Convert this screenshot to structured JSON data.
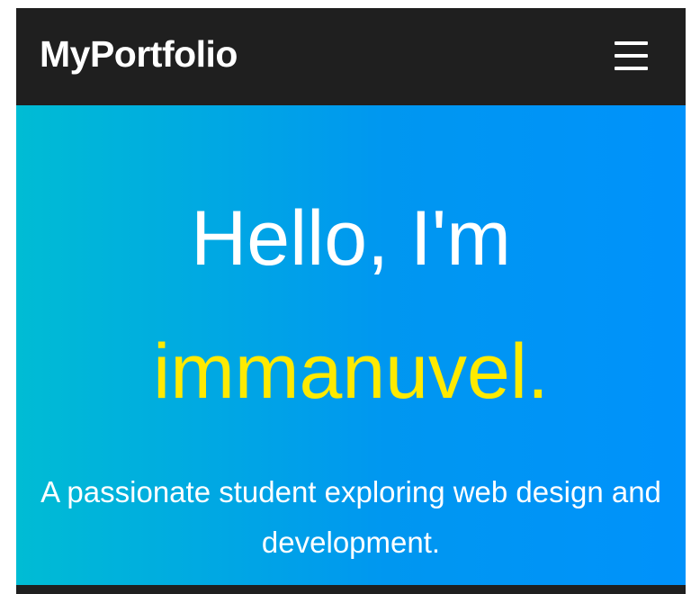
{
  "navbar": {
    "brand": "MyPortfolio",
    "menu_icon": "hamburger-menu-icon"
  },
  "hero": {
    "greeting": "Hello, I'm",
    "name": "immanuvel.",
    "tagline": "A passionate student exploring web design and development."
  },
  "colors": {
    "navbar_bg": "#1f1f1f",
    "hero_gradient_start": "#00bcd4",
    "hero_gradient_end": "#0092fb",
    "name_accent": "#ffea00",
    "text": "#ffffff"
  }
}
